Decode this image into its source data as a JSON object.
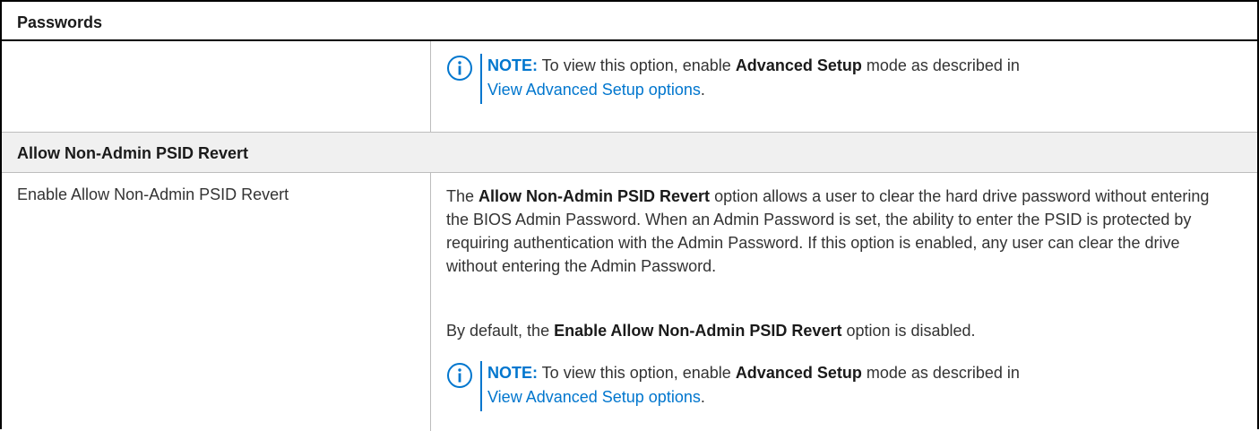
{
  "table": {
    "header_title": "Passwords",
    "section_title": "Allow Non-Admin PSID Revert"
  },
  "note_top": {
    "label": "NOTE:",
    "pre": " To view this option, enable ",
    "bold": "Advanced Setup",
    "post": " mode as described in",
    "link": "View Advanced Setup options",
    "end": "."
  },
  "option": {
    "name": "Enable Allow Non-Admin PSID Revert",
    "desc_pre": "The ",
    "desc_bold": "Allow Non-Admin PSID Revert",
    "desc_post": " option allows a user to clear the hard drive password without entering the BIOS Admin Password. When an Admin Password is set, the ability to enter the PSID is protected by requiring authentication with the Admin Password. If this option is enabled, any user can clear the drive without entering the Admin Password.",
    "default_pre": "By default, the ",
    "default_bold": "Enable Allow Non-Admin PSID Revert",
    "default_post": " option is disabled."
  },
  "note_bottom": {
    "label": "NOTE:",
    "pre": " To view this option, enable ",
    "bold": "Advanced Setup",
    "post": " mode as described in",
    "link": "View Advanced Setup options",
    "end": "."
  },
  "colors": {
    "accent": "#0076ce",
    "section_bg": "#f0f0f0",
    "border": "#000000",
    "grid": "#bdbdbd"
  },
  "icons": {
    "note": "info-circle-icon"
  }
}
